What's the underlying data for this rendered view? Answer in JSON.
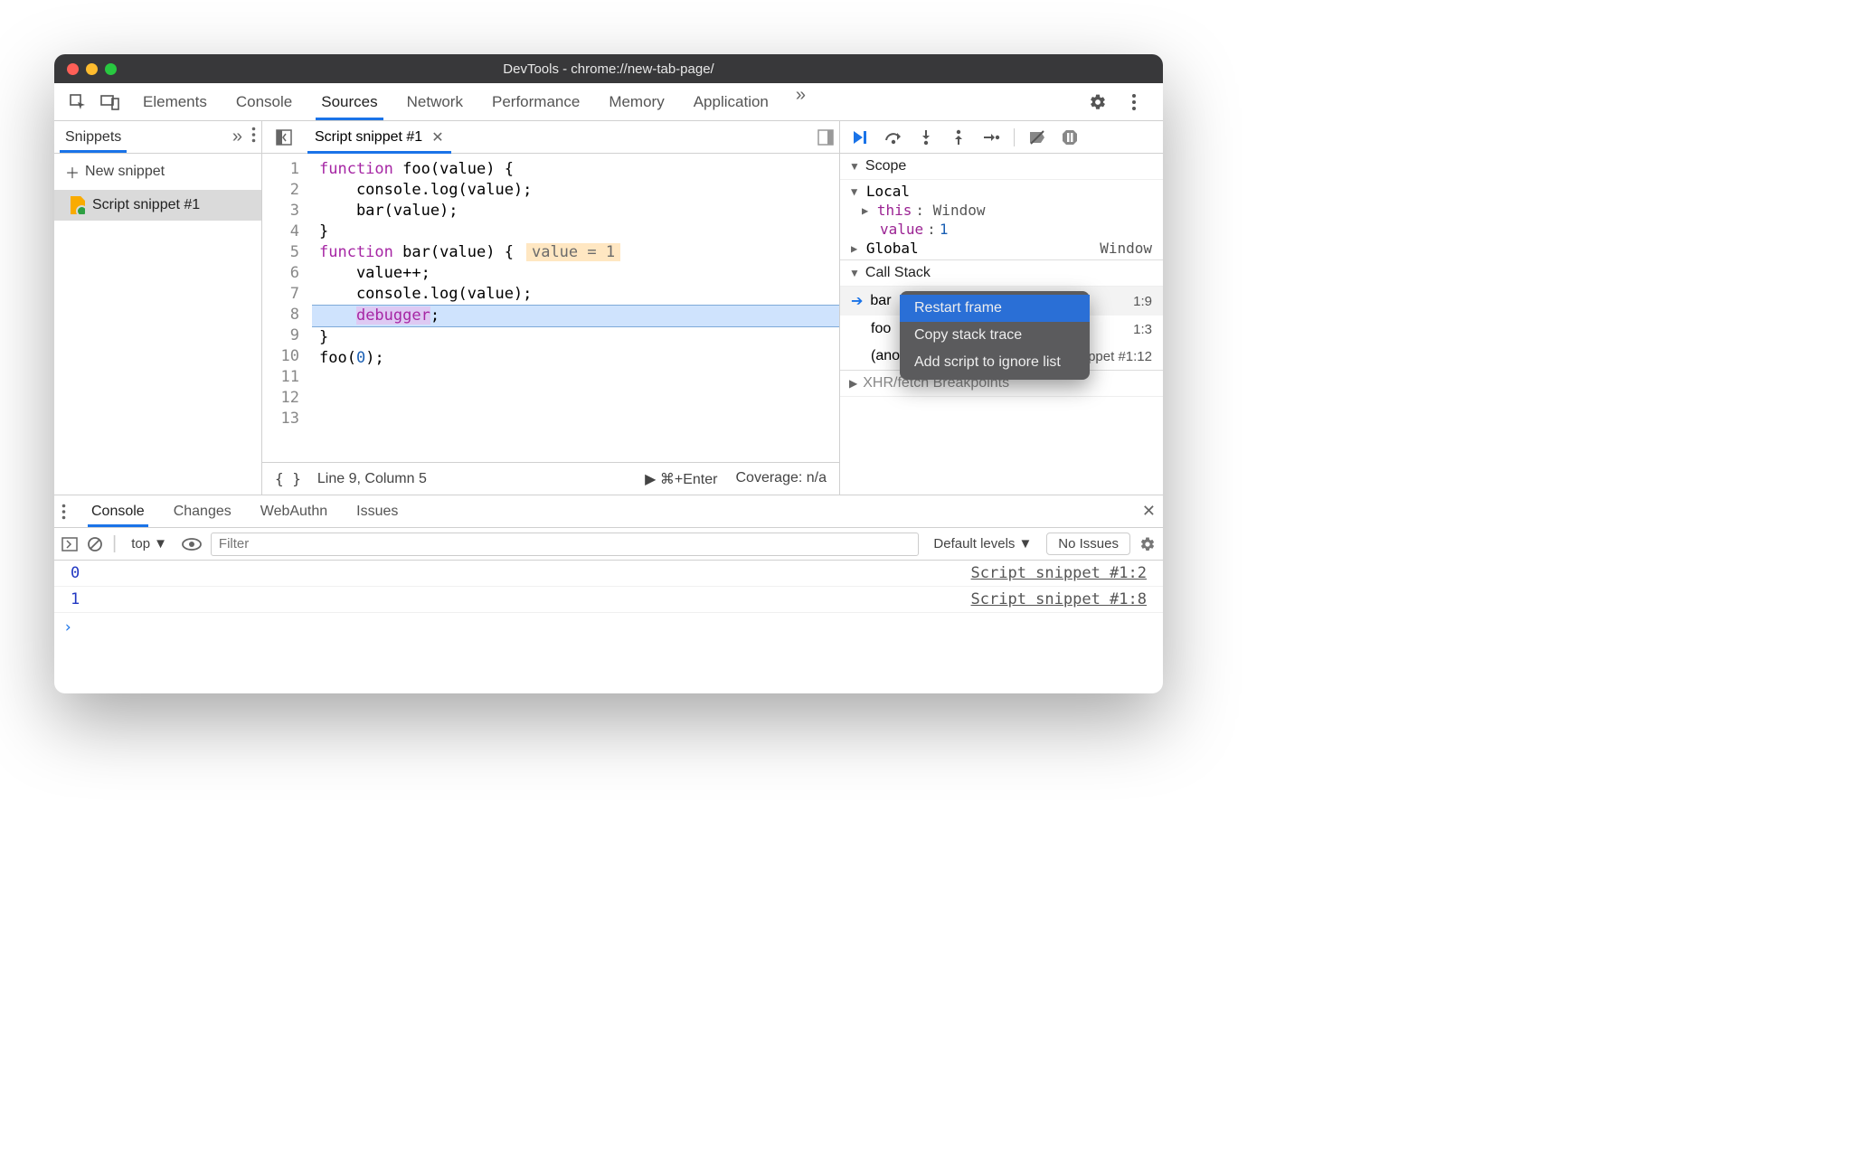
{
  "window": {
    "title": "DevTools - chrome://new-tab-page/"
  },
  "mainTabs": {
    "items": [
      "Elements",
      "Console",
      "Sources",
      "Network",
      "Performance",
      "Memory",
      "Application"
    ],
    "active": "Sources",
    "more": "»"
  },
  "sidebar": {
    "tab": "Snippets",
    "more": "»",
    "newLabel": "New snippet",
    "items": [
      "Script snippet #1"
    ]
  },
  "editor": {
    "toggleNavIcon": "◧",
    "tab": "Script snippet #1",
    "lines": 13,
    "code": {
      "l1a": "function",
      "l1b": " foo",
      "l1c": "(value) {",
      "l2": "    console.log(value);",
      "l3": "    bar(value);",
      "l4": "}",
      "l5": "",
      "l6a": "function",
      "l6b": " bar",
      "l6c": "(value) {",
      "l6hint": "value = 1",
      "l7": "    value++;",
      "l8": "    console.log(value);",
      "l9a": "    ",
      "l9b": "debugger",
      "l9c": ";",
      "l10": "}",
      "l11": "",
      "l12a": "foo(",
      "l12b": "0",
      "l12c": ");",
      "l13": ""
    },
    "status": {
      "brackets": "{ }",
      "pos": "Line 9, Column 5",
      "run": "▶ ⌘+Enter",
      "coverage": "Coverage: n/a"
    }
  },
  "debugger": {
    "scope": {
      "header": "Scope",
      "local": "Local",
      "thisLabel": "this",
      "thisVal": ": Window",
      "valueLabel": "value",
      "valueVal": "1",
      "global": "Global",
      "globalVal": "Window"
    },
    "callstack": {
      "header": "Call Stack",
      "items": [
        {
          "name": "bar",
          "loc": "1:9"
        },
        {
          "name": "foo",
          "loc": "1:3"
        },
        {
          "name": "(anor",
          "loc": "Script snippet #1:12"
        }
      ]
    },
    "xhr": "XHR/fetch Breakpoints",
    "contextMenu": {
      "restart": "Restart frame",
      "copy": "Copy stack trace",
      "ignore": "Add script to ignore list"
    }
  },
  "drawer": {
    "tabs": [
      "Console",
      "Changes",
      "WebAuthn",
      "Issues"
    ],
    "active": "Console",
    "context": "top",
    "filterPlaceholder": "Filter",
    "levels": "Default levels",
    "noIssues": "No Issues",
    "logs": [
      {
        "v": "0",
        "src": "Script snippet #1:2"
      },
      {
        "v": "1",
        "src": "Script snippet #1:8"
      }
    ]
  }
}
